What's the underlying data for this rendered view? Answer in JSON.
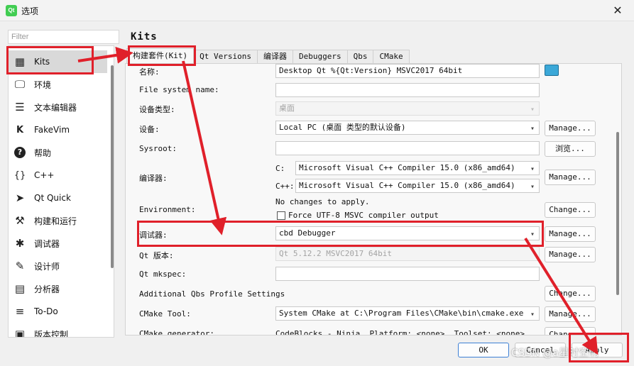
{
  "window": {
    "title": "选项",
    "app_icon_text": "Qt",
    "close_glyph": "✕"
  },
  "filter": {
    "placeholder": "Filter"
  },
  "nav": {
    "items": [
      {
        "label": "Kits",
        "icon": "kits-icon",
        "glyph": "▦"
      },
      {
        "label": "环境",
        "icon": "monitor-icon",
        "glyph": "🖵"
      },
      {
        "label": "文本编辑器",
        "icon": "text-editor-icon",
        "glyph": "☰"
      },
      {
        "label": "FakeVim",
        "icon": "fakevim-icon",
        "glyph": "K"
      },
      {
        "label": "帮助",
        "icon": "help-icon",
        "glyph": "?"
      },
      {
        "label": "C++",
        "icon": "braces-icon",
        "glyph": "{}"
      },
      {
        "label": "Qt Quick",
        "icon": "qt-quick-icon",
        "glyph": "➤"
      },
      {
        "label": "构建和运行",
        "icon": "hammer-icon",
        "glyph": "⚒"
      },
      {
        "label": "调试器",
        "icon": "bug-icon",
        "glyph": "✱"
      },
      {
        "label": "设计师",
        "icon": "pencil-icon",
        "glyph": "✎"
      },
      {
        "label": "分析器",
        "icon": "analyzer-icon",
        "glyph": "▤"
      },
      {
        "label": "To-Do",
        "icon": "todo-list-icon",
        "glyph": "≡"
      },
      {
        "label": "版本控制",
        "icon": "version-control-icon",
        "glyph": "▣"
      }
    ]
  },
  "main": {
    "title": "Kits",
    "tabs": [
      "构建套件(Kit)",
      "Qt Versions",
      "编译器",
      "Debuggers",
      "Qbs",
      "CMake"
    ],
    "fields": {
      "name": {
        "label": "名称:",
        "value": "Desktop Qt %{Qt:Version} MSVC2017 64bit"
      },
      "file_system_name": {
        "label": "File system name:",
        "value": ""
      },
      "device_type": {
        "label": "设备类型:",
        "value": "桌面"
      },
      "device": {
        "label": "设备:",
        "value": "Local PC (桌面 类型的默认设备)",
        "button": "Manage..."
      },
      "sysroot": {
        "label": "Sysroot:",
        "value": "",
        "button": "浏览..."
      },
      "compiler": {
        "label": "编译器:",
        "c_label": "C:",
        "c_value": "Microsoft Visual C++ Compiler 15.0 (x86_amd64)",
        "cpp_label": "C++:",
        "cpp_value": "Microsoft Visual C++ Compiler 15.0 (x86_amd64)",
        "button": "Manage..."
      },
      "environment": {
        "label": "Environment:",
        "note": "No changes to apply.",
        "checkbox_label": "Force UTF-8 MSVC compiler output",
        "checkbox_checked": false,
        "button": "Change..."
      },
      "debugger": {
        "label": "调试器:",
        "value": "cbd Debugger",
        "button": "Manage..."
      },
      "qt_version": {
        "label": "Qt 版本:",
        "value": "Qt 5.12.2 MSVC2017 64bit",
        "button": "Manage..."
      },
      "qt_mkspec": {
        "label": "Qt mkspec:",
        "value": ""
      },
      "qbs_settings": {
        "label": "Additional Qbs Profile Settings",
        "button": "Change..."
      },
      "cmake_tool": {
        "label": "CMake Tool:",
        "value": "System CMake at C:\\Program Files\\CMake\\bin\\cmake.exe",
        "button": "Manage..."
      },
      "cmake_generator": {
        "label": "CMake generator:",
        "value": "CodeBlocks - Ninja, Platform: <none>, Toolset: <none>",
        "button": "Change..."
      }
    }
  },
  "footer": {
    "ok": "OK",
    "cancel": "Cancel",
    "apply": "Apply"
  },
  "watermark": "CSDN @a星时空啊",
  "colors": {
    "annotation_red": "#e0202a",
    "monitor_blue": "#3ba8d8"
  }
}
